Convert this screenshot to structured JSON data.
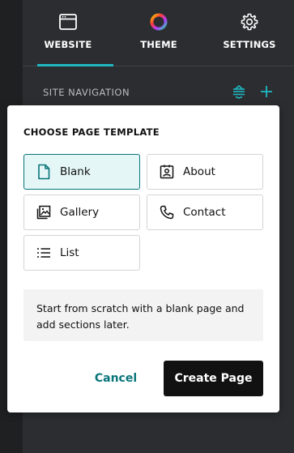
{
  "tabs": [
    {
      "label": "WEBSITE",
      "icon": "browser-window-icon",
      "active": true
    },
    {
      "label": "THEME",
      "icon": "color-wheel-icon",
      "active": false
    },
    {
      "label": "SETTINGS",
      "icon": "gear-icon",
      "active": false
    }
  ],
  "site_nav": {
    "label": "SITE NAVIGATION",
    "reorder_icon": "reorder-icon",
    "add_icon": "plus-icon"
  },
  "modal": {
    "title": "CHOOSE PAGE TEMPLATE",
    "templates": [
      {
        "label": "Blank",
        "icon": "blank-page-icon",
        "selected": true
      },
      {
        "label": "About",
        "icon": "about-contact-card-icon",
        "selected": false
      },
      {
        "label": "Gallery",
        "icon": "gallery-image-icon",
        "selected": false
      },
      {
        "label": "Contact",
        "icon": "phone-icon",
        "selected": false
      },
      {
        "label": "List",
        "icon": "list-icon",
        "selected": false
      }
    ],
    "description": "Start from scratch with a blank page and add sections later.",
    "cancel_label": "Cancel",
    "create_label": "Create Page"
  },
  "colors": {
    "accent": "#1fb7c1",
    "teal_dark": "#09757a",
    "selected_bg": "#e4f6f6",
    "panel_bg": "#2b2d30",
    "button_dark": "#111111"
  }
}
